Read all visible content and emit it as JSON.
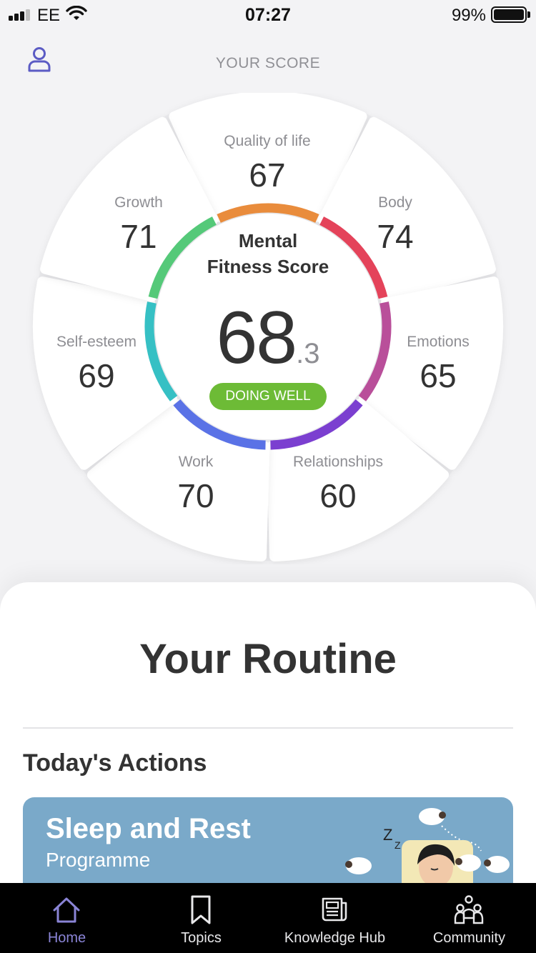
{
  "status_bar": {
    "carrier": "EE",
    "time": "07:27",
    "battery_percent": "99%",
    "battery_level": 0.99,
    "signal_bars": 3
  },
  "header": {
    "title": "YOUR SCORE",
    "profile_icon": "person-icon"
  },
  "score": {
    "title_line1": "Mental",
    "title_line2": "Fitness Score",
    "value_int": "68",
    "value_dec": ".3",
    "status": "DOING WELL",
    "status_color": "#6dbb36"
  },
  "segments": [
    {
      "label": "Quality of life",
      "value": "67",
      "color": "#e98c3c"
    },
    {
      "label": "Body",
      "value": "74",
      "color": "#e4435a"
    },
    {
      "label": "Emotions",
      "value": "65",
      "color": "#b94f9a"
    },
    {
      "label": "Relationships",
      "value": "60",
      "color": "#7b3fd0"
    },
    {
      "label": "Work",
      "value": "70",
      "color": "#5a72e6"
    },
    {
      "label": "Self-esteem",
      "value": "69",
      "color": "#36c0c4"
    },
    {
      "label": "Growth",
      "value": "71",
      "color": "#55c979"
    }
  ],
  "routine": {
    "title": "Your Routine",
    "section_title": "Today's Actions",
    "card": {
      "title": "Sleep and Rest",
      "subtitle": "Programme",
      "background": "#7aa9c9"
    }
  },
  "tabs": [
    {
      "label": "Home",
      "icon": "home-icon",
      "active": true
    },
    {
      "label": "Topics",
      "icon": "bookmark-icon",
      "active": false
    },
    {
      "label": "Knowledge Hub",
      "icon": "newspaper-icon",
      "active": false
    },
    {
      "label": "Community",
      "icon": "people-icon",
      "active": false
    }
  ],
  "accent_color": "#8a84d6"
}
